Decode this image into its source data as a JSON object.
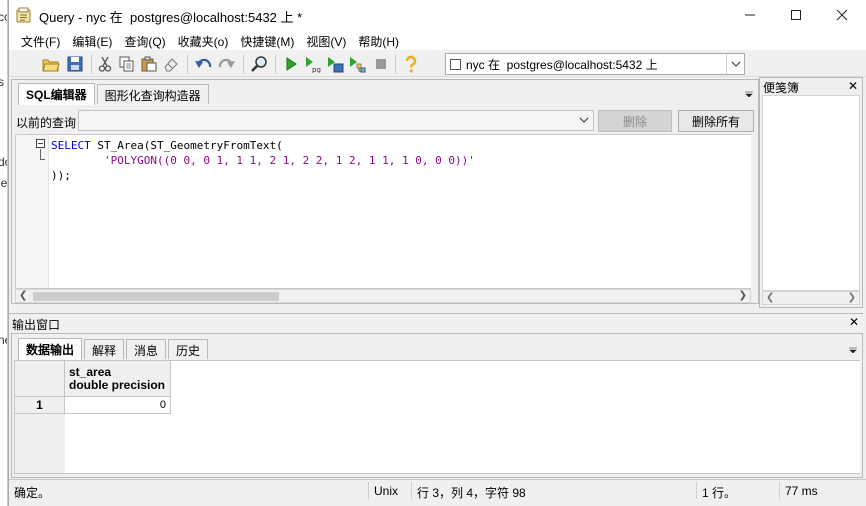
{
  "window": {
    "title": "Query - nyc 在  postgres@localhost:5432 上 *",
    "controls": {
      "minimize": "—",
      "maximize": "☐",
      "close": "✕"
    }
  },
  "menu": [
    "文件(F)",
    "编辑(E)",
    "查询(Q)",
    "收藏夹(o)",
    "快捷键(M)",
    "视图(V)",
    "帮助(H)"
  ],
  "toolbar": {
    "icons": [
      "open-icon",
      "save-icon",
      "cut-icon",
      "copy-icon",
      "paste-icon",
      "clear-icon",
      "undo-icon",
      "redo-icon",
      "find-icon",
      "execute-icon",
      "execute-pgscript-icon",
      "execute-to-file-icon",
      "explain-icon",
      "cancel-icon",
      "help-icon"
    ],
    "connection": "nyc 在  postgres@localhost:5432 上"
  },
  "editor": {
    "tabs": [
      "SQL编辑器",
      "图形化查询构造器"
    ],
    "history_label": "以前的查询",
    "delete_label": "删除",
    "delete_all_label": "删除所有",
    "code": {
      "line1_kw": "SELECT",
      "line1_rest": " ST_Area(ST_GeometryFromText(",
      "line2_indent": "        ",
      "line2_str": "'POLYGON((0 0, 0 1, 1 1, 2 1, 2 2, 1 2, 1 1, 1 0, 0 0))'",
      "line3": "));"
    }
  },
  "clipboard": {
    "title": "便笺簿",
    "close": "✕"
  },
  "output": {
    "title": "输出窗口",
    "close": "✕",
    "tabs": [
      "数据输出",
      "解释",
      "消息",
      "历史"
    ],
    "grid": {
      "column": {
        "name": "st_area",
        "type": "double precision"
      },
      "rows": [
        {
          "index": "1",
          "value": "0"
        }
      ]
    }
  },
  "edge_text": [
    "co",
    "s",
    "do",
    "le",
    "ne"
  ],
  "status": {
    "message": "确定。",
    "line_ending": "Unix",
    "position": "行 3，列 4，字符 98",
    "rows": "1 行。",
    "time": "77 ms"
  },
  "colors": {
    "keyword": "#0000c8",
    "string": "#8c0a8c",
    "execute": "#2fa32f"
  }
}
